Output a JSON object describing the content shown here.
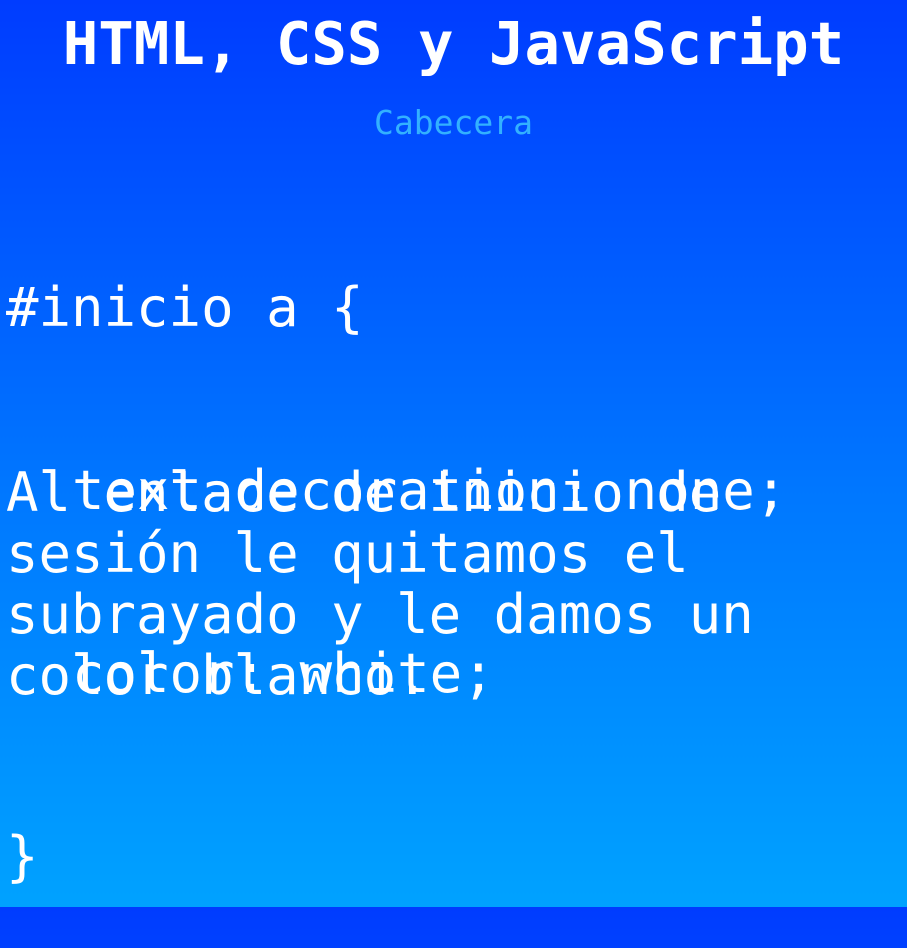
{
  "title": "HTML, CSS y JavaScript",
  "subtitle": "Cabecera",
  "code_lines": [
    "#inicio a {",
    "text-decoration: none;",
    "color: white;",
    "}"
  ],
  "description_lines": [
    "Al enlace de inicio de",
    "sesión le quitamos el",
    "subrayado y le damos un",
    "color blanco."
  ],
  "colors": {
    "background_top": "#003cff",
    "background_bottom": "#00a2ff",
    "text": "#ffffff",
    "subtitle": "#33b1ff"
  }
}
